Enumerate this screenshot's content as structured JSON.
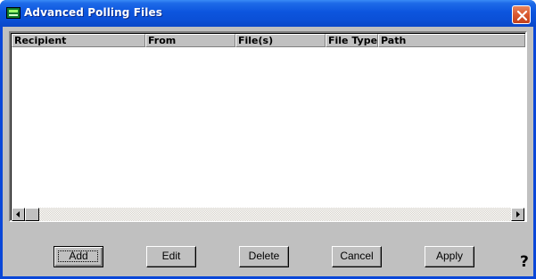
{
  "window": {
    "title": "Advanced Polling Files",
    "app_icon": "terminal-icon",
    "close_icon": "close-icon"
  },
  "list": {
    "columns": [
      "Recipient",
      "From",
      "File(s)",
      "File Type",
      "Path"
    ],
    "rows": []
  },
  "scrollbar": {
    "left_arrow": "scroll-left-icon",
    "right_arrow": "scroll-right-icon"
  },
  "buttons": {
    "add": "Add",
    "edit": "Edit",
    "delete": "Delete",
    "cancel": "Cancel",
    "apply": "Apply"
  },
  "help": {
    "label": "?"
  },
  "colors": {
    "titlebar": "#0b4fd6",
    "close": "#d9582f",
    "face": "#c0c0c0"
  }
}
